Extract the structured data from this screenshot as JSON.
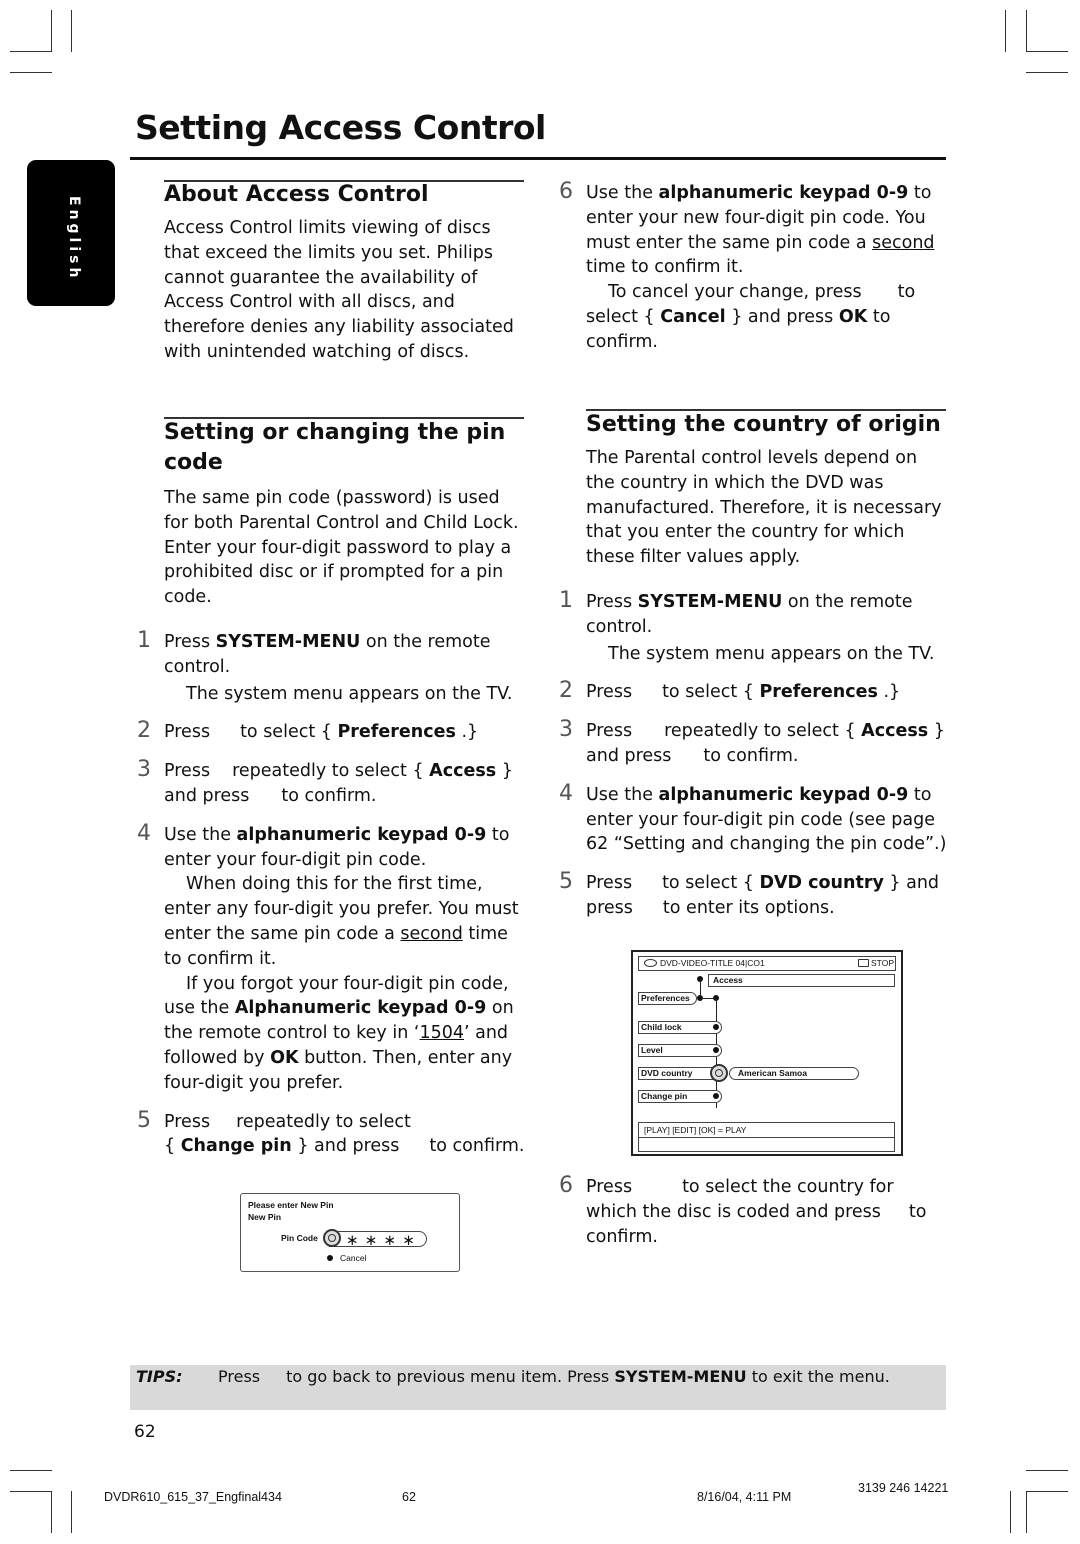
{
  "page": {
    "title": "Setting Access Control",
    "language_tab": "English",
    "page_number": "62"
  },
  "about": {
    "heading": "About Access Control",
    "body": "Access Control limits viewing of discs that exceed the limits you set.  Philips cannot guarantee the availability of Access Control with all discs, and therefore denies any liability associated with unintended watching of discs."
  },
  "pin_section": {
    "heading": "Setting or changing the pin code",
    "intro": "The same pin code (password) is used for both Parental Control and Child Lock. Enter your four-digit password to play a prohibited disc or if prompted for a pin code.",
    "steps": [
      {
        "num": "1",
        "pre": "Press ",
        "bold": "SYSTEM-MENU",
        "post": " on the remote control.",
        "note": "The system menu appears on the TV."
      },
      {
        "num": "2",
        "pre": "Press",
        "post": "to select { ",
        "bold": "Preferences",
        "end": " .}"
      },
      {
        "num": "3",
        "pre": "Press",
        "mid": "repeatedly to select { ",
        "bold": "Access",
        "end": " }",
        "line2a": "and press",
        "line2b": "to confirm."
      },
      {
        "num": "4",
        "pre": "Use the ",
        "bold": "alphanumeric keypad 0-9",
        "post": " to enter your four-digit pin code.",
        "note1_a": "When doing this for the first time, enter any four-digit you prefer. You must enter the same pin code a ",
        "note1_u": "second",
        "note1_b": " time to confirm it.",
        "note2_a": "If you forgot your four-digit pin code, use the ",
        "note2_bold": "Alphanumeric keypad 0-9",
        "note2_b": " on the remote control to key in ‘",
        "note2_u": "1504",
        "note2_c": "’ and followed by ",
        "note2_ok": "OK",
        "note2_d": " button.  Then, enter any four-digit you prefer."
      },
      {
        "num": "5",
        "pre": "Press",
        "mid": "repeatedly to select",
        "line2_open": "{ ",
        "bold": "Change pin",
        "line2_close": " } and press",
        "end": "to confirm."
      }
    ],
    "step6": {
      "num": "6",
      "pre": "Use the ",
      "bold": "alphanumeric keypad 0-9",
      "post": " to enter your new four-digit pin code. You must enter the same pin code a ",
      "u": "second",
      "post2": " time to confirm it.",
      "note_a": "To cancel your change, press",
      "note_b": "to select { ",
      "note_bold": "Cancel",
      "note_c": " } and press ",
      "note_ok": "OK",
      "note_d": " to confirm."
    }
  },
  "pin_dialog": {
    "line1": "Please enter New Pin",
    "line2": "New Pin",
    "label": "Pin Code",
    "value": "∗ ∗ ∗ ∗",
    "cancel": "Cancel"
  },
  "country_section": {
    "heading": "Setting the country of origin",
    "intro": "The Parental control levels depend on the country in which the DVD was manufactured.  Therefore, it is necessary that you enter the country for which these filter values apply.",
    "steps": [
      {
        "num": "1",
        "pre": "Press ",
        "bold": "SYSTEM-MENU",
        "post": " on the remote control.",
        "note": "The system menu appears on the TV."
      },
      {
        "num": "2",
        "pre": "Press",
        "post": "to select { ",
        "bold": "Preferences",
        "end": " .}"
      },
      {
        "num": "3",
        "pre": "Press",
        "mid": "repeatedly to select { ",
        "bold": "Access",
        "end": " }",
        "line2a": "and press",
        "line2b": "to confirm."
      },
      {
        "num": "4",
        "pre": "Use the ",
        "bold": "alphanumeric keypad 0-9",
        "post": " to enter your four-digit pin code (see page 62 “Setting and changing the pin code”.)"
      },
      {
        "num": "5",
        "pre": "Press",
        "mid": "to select { ",
        "bold": "DVD country",
        "end": " } and",
        "line2a": "press",
        "line2b": "to enter its options."
      },
      {
        "num": "6",
        "pre": "Press",
        "mid": "to select the country for",
        "line2a": "which the disc is coded and press",
        "line2b": "to",
        "line3": "confirm."
      }
    ]
  },
  "osd": {
    "disc_title": "DVD-VIDEO-TITLE 04|CO1",
    "status": "STOP",
    "breadcrumb": "Access",
    "menu_root": "Preferences",
    "items": [
      "Child lock",
      "Level",
      "DVD country",
      "Change pin"
    ],
    "selected_item": "DVD country",
    "selected_value": "American Samoa",
    "help": "[PLAY] [EDIT] [OK] = PLAY"
  },
  "tips": {
    "label": "TIPS:",
    "pre": "Press",
    "mid": "to go back to previous menu item.  Press ",
    "bold": "SYSTEM-MENU",
    "post": " to exit the menu."
  },
  "footer": {
    "file": "DVDR610_615_37_Engfinal434",
    "page": "62",
    "datetime": "8/16/04, 4:11 PM",
    "code": "3139 246 14221"
  }
}
